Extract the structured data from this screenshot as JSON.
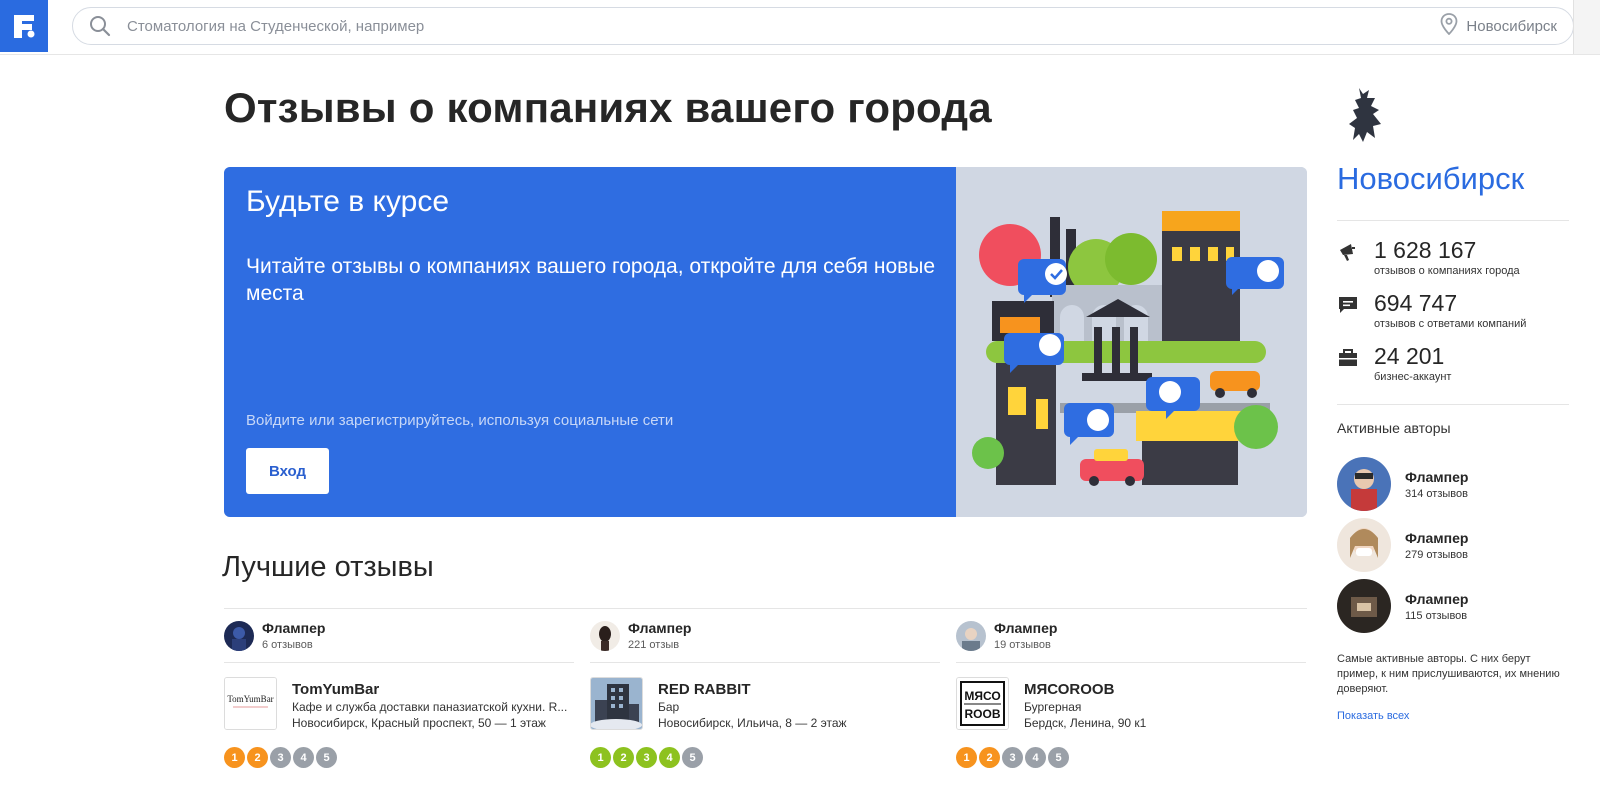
{
  "header": {
    "logo_letter": "F",
    "search_placeholder": "Стоматология на Студенческой, например",
    "city": "Новосибирск"
  },
  "page_title": "Отзывы о компаниях вашего города",
  "hero": {
    "title": "Будьте в курсе",
    "description": "Читайте отзывы о компаниях вашего города, откройте для себя новые места",
    "register_text": "Войдите или зарегистрируйтесь, используя социальные сети",
    "login_label": "Вход",
    "colors": {
      "left_bg": "#2f6de1",
      "right_bg": "#d0d7e3"
    }
  },
  "best_reviews": {
    "title": "Лучшие отзывы",
    "items": [
      {
        "author": "Флампер",
        "author_reviews": "6 отзывов",
        "company": "TomYumBar",
        "type": "Кафе и служба доставки паназиатской кухни. R...",
        "address": "Новосибирск, Красный проспект, 50 — 1 этаж",
        "logo_text": "TomYumBar",
        "rating": [
          "1",
          "2",
          "3",
          "4",
          "5"
        ],
        "rating_filled": 2,
        "rating_color": "#f7931e"
      },
      {
        "author": "Флампер",
        "author_reviews": "221 отзыв",
        "company": "RED RABBIT",
        "type": "Бар",
        "address": "Новосибирск, Ильича, 8 — 2 этаж",
        "logo_text": "",
        "rating": [
          "1",
          "2",
          "3",
          "4",
          "5"
        ],
        "rating_filled": 4,
        "rating_color": "#8dc21f"
      },
      {
        "author": "Флампер",
        "author_reviews": "19 отзывов",
        "company": "МЯСОROOB",
        "type": "Бургерная",
        "address": "Бердск, Ленина, 90 к1",
        "logo_text_top": "МЯСО",
        "logo_text_bottom": "ROOB",
        "rating": [
          "1",
          "2",
          "3",
          "4",
          "5"
        ],
        "rating_filled": 2,
        "rating_color": "#f7931e"
      }
    ]
  },
  "sidebar": {
    "city": "Новосибирск",
    "stats": [
      {
        "icon": "megaphone-icon",
        "number": "1 628 167",
        "label": "отзывов о компаниях города"
      },
      {
        "icon": "comment-icon",
        "number": "694 747",
        "label": "отзывов с ответами компаний"
      },
      {
        "icon": "briefcase-icon",
        "number": "24 201",
        "label": "бизнес-аккаунт"
      }
    ],
    "active_title": "Активные авторы",
    "authors": [
      {
        "name": "Флампер",
        "reviews": "314 отзывов"
      },
      {
        "name": "Флампер",
        "reviews": "279 отзывов"
      },
      {
        "name": "Флампер",
        "reviews": "115 отзывов"
      }
    ],
    "note": "Самые активные авторы. С них берут пример, к ним прислушиваются, их мнению доверяют.",
    "show_all": "Показать всех"
  },
  "colors": {
    "brand": "#2a6be0",
    "rating_inactive": "#9aa0a8"
  }
}
